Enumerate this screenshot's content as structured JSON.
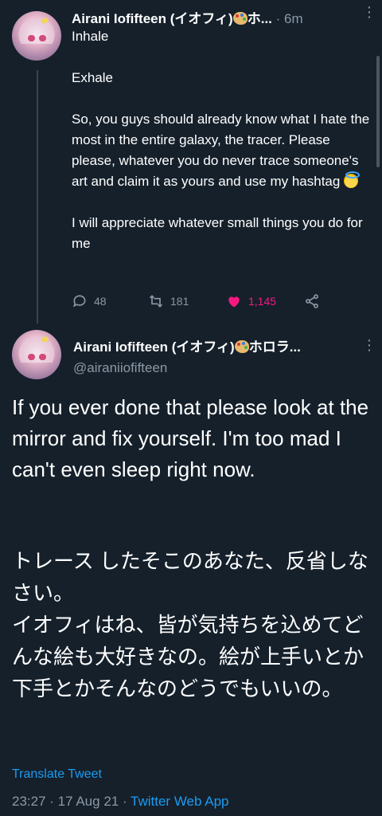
{
  "tweet1": {
    "display_name": "Airani Iofifteen (イオフィ)",
    "name_suffix": "ホ...",
    "time": "· 6m",
    "paragraphs": [
      "Inhale",
      "Exhale",
      " So, you guys should already know what I hate the most in the entire galaxy, the tracer. Please please, whatever you do never trace someone's art and claim it as yours and use my hashtag",
      "I will appreciate whatever small things you do for me"
    ],
    "replies": "48",
    "retweets": "181",
    "likes": "1,145"
  },
  "tweet2": {
    "display_name": "Airani Iofifteen (イオフィ)",
    "name_suffix": "ホロラ...",
    "handle": "@airaniiofifteen",
    "text_en": "If you ever done that please look at the mirror and fix yourself. I'm too mad I can't even sleep right now.",
    "text_jp_1": "トレース したそこのあなた、反省しなさい。",
    "text_jp_2": "イオフィはね、皆が気持ちを込めてどんな絵も大好きなの。絵が上手いとか下手とかそんなのどうでもいいの。",
    "translate_label": "Translate Tweet",
    "timestamp": "23:27 · 17 Aug 21 ·",
    "source_app": "Twitter Web App"
  },
  "colors": {
    "background": "#15202b",
    "muted": "#8b98a5",
    "accent": "#1d9bf0",
    "like": "#f91880"
  },
  "icons": [
    "more-icon",
    "reply-icon",
    "retweet-icon",
    "like-icon",
    "share-icon",
    "palette-emoji",
    "halo-smile-emoji"
  ]
}
